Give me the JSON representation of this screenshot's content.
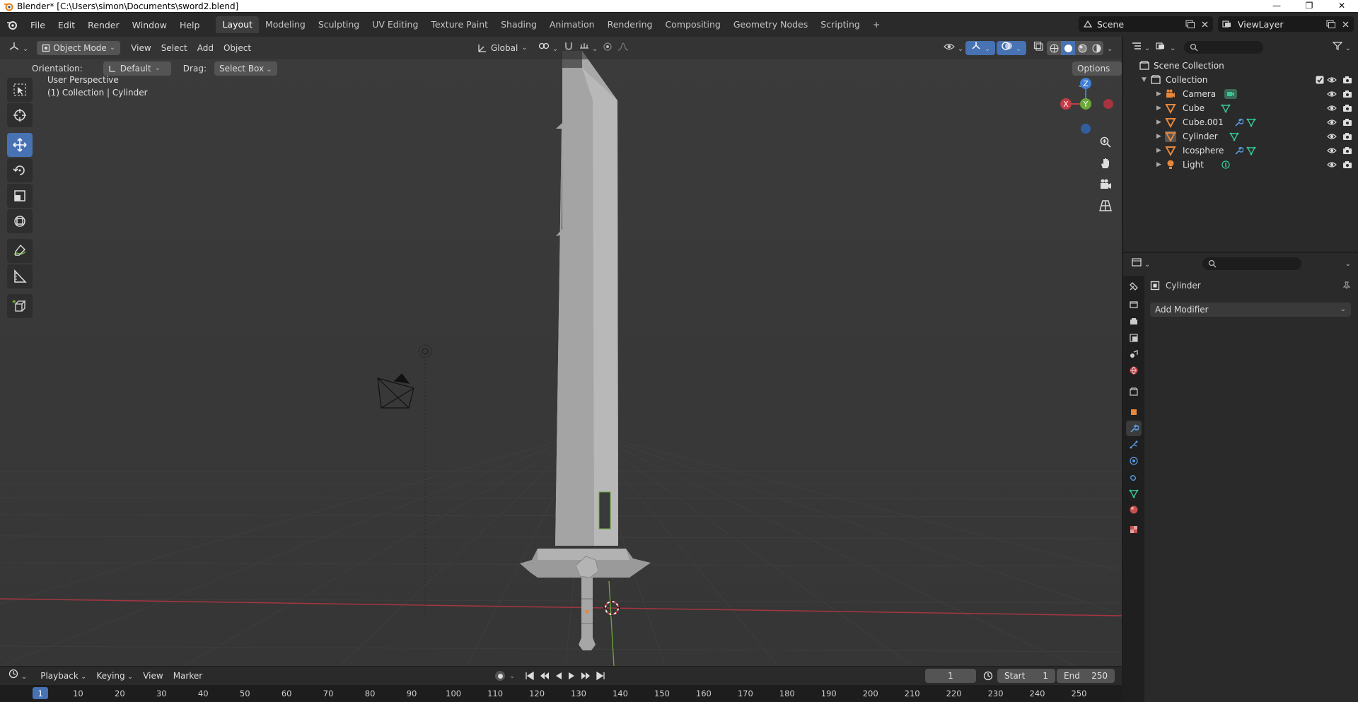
{
  "titlebar": {
    "title": "Blender* [C:\\Users\\simon\\Documents\\sword2.blend]",
    "minimize": "—",
    "restore": "❐",
    "close": "✕"
  },
  "menu": [
    "File",
    "Edit",
    "Render",
    "Window",
    "Help"
  ],
  "workspaces": [
    "Layout",
    "Modeling",
    "Sculpting",
    "UV Editing",
    "Texture Paint",
    "Shading",
    "Animation",
    "Rendering",
    "Compositing",
    "Geometry Nodes",
    "Scripting"
  ],
  "workspace_add": "+",
  "scene": {
    "name": "Scene",
    "view_layer": "ViewLayer"
  },
  "viewport": {
    "mode": "Object Mode",
    "menus": [
      "View",
      "Select",
      "Add",
      "Object"
    ],
    "transform_orientation": "Global",
    "orientation_label": "Orientation:",
    "orientation_value": "Default",
    "drag_label": "Drag:",
    "drag_value": "Select Box",
    "options": "Options",
    "overlay_line1": "User Perspective",
    "overlay_line2": "(1) Collection | Cylinder",
    "gizmo": {
      "x": "X",
      "y": "Y",
      "z": "Z"
    }
  },
  "outliner": {
    "root": "Scene Collection",
    "collection": "Collection",
    "items": [
      {
        "name": "Camera",
        "icon": "camera-icon",
        "color": "#e8863a"
      },
      {
        "name": "Cube",
        "icon": "mesh-icon",
        "color": "#e8863a"
      },
      {
        "name": "Cube.001",
        "icon": "mesh-icon",
        "color": "#e8863a"
      },
      {
        "name": "Cylinder",
        "icon": "mesh-icon",
        "color": "#e8863a"
      },
      {
        "name": "Icosphere",
        "icon": "mesh-icon",
        "color": "#e8863a"
      },
      {
        "name": "Light",
        "icon": "light-icon",
        "color": "#e8863a"
      }
    ]
  },
  "properties": {
    "object_name": "Cylinder",
    "add_modifier": "Add Modifier"
  },
  "timeline": {
    "menus": [
      "Playback",
      "Keying",
      "View",
      "Marker"
    ],
    "current_frame": "1",
    "start_label": "Start",
    "start": "1",
    "end_label": "End",
    "end": "250",
    "ticks": [
      "1",
      "10",
      "20",
      "30",
      "40",
      "50",
      "60",
      "70",
      "80",
      "90",
      "100",
      "110",
      "120",
      "130",
      "140",
      "150",
      "160",
      "170",
      "180",
      "190",
      "200",
      "210",
      "220",
      "230",
      "240",
      "250"
    ]
  },
  "colors": {
    "accent": "#4772b3",
    "axis_x": "#c53b45",
    "axis_y": "#6da83a",
    "axis_z": "#3f7fd5",
    "object": "#e8863a",
    "modifier": "#5a98dd",
    "mesh_data": "#35c79a"
  }
}
